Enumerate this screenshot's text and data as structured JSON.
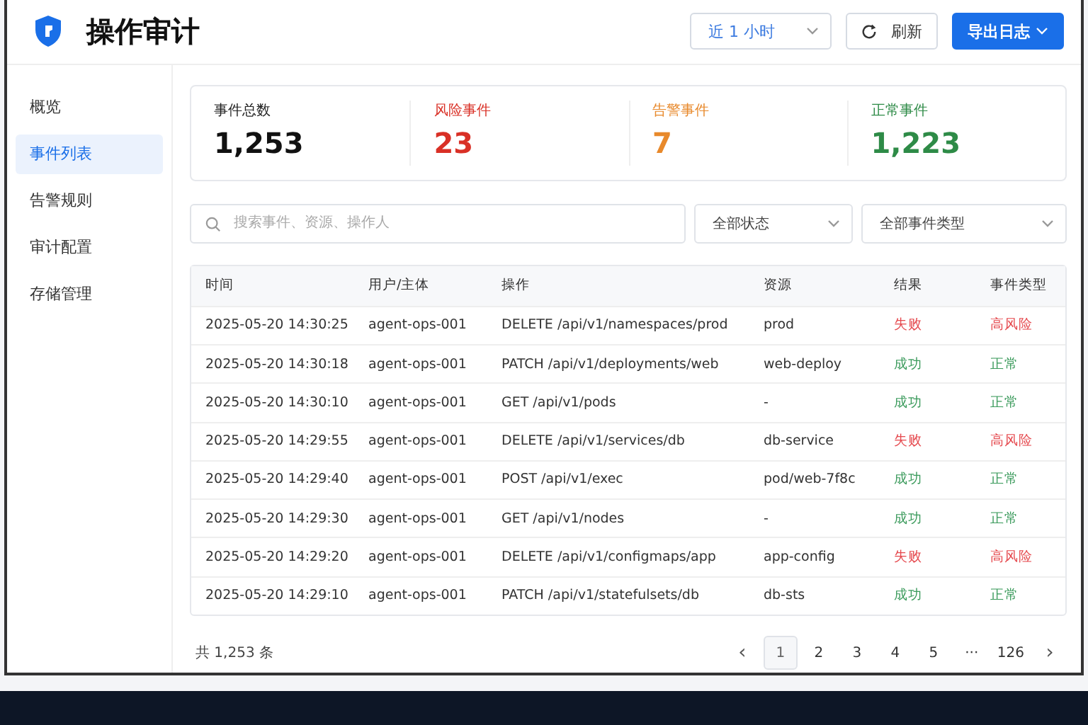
{
  "header": {
    "title": "操作审计",
    "time_range": "近 1 小时",
    "refresh": "刷新",
    "export": "导出日志"
  },
  "sidebar": {
    "items": [
      {
        "label": "概览",
        "selected": false
      },
      {
        "label": "事件列表",
        "selected": true
      },
      {
        "label": "告警规则",
        "selected": false
      },
      {
        "label": "审计配置",
        "selected": false
      },
      {
        "label": "存储管理",
        "selected": false
      }
    ]
  },
  "stats": [
    {
      "label": "事件总数",
      "value": "1,253",
      "kind": "total"
    },
    {
      "label": "风险事件",
      "value": "23",
      "kind": "risk"
    },
    {
      "label": "告警事件",
      "value": "7",
      "kind": "warning"
    },
    {
      "label": "正常事件",
      "value": "1,223",
      "kind": "normal"
    }
  ],
  "filters": {
    "search_placeholder": "搜索事件、资源、操作人",
    "status": "全部状态",
    "event_type": "全部事件类型"
  },
  "table": {
    "columns": [
      "时间",
      "用户/主体",
      "操作",
      "资源",
      "结果",
      "事件类型"
    ],
    "rows": [
      {
        "time": "2025-05-20 14:30:25",
        "user": "agent-ops-001",
        "operation": "DELETE /api/v1/namespaces/prod",
        "resource": "prod",
        "result": "失败",
        "event_type": "高风险",
        "kind": "fail"
      },
      {
        "time": "2025-05-20 14:30:18",
        "user": "agent-ops-001",
        "operation": "PATCH /api/v1/deployments/web",
        "resource": "web-deploy",
        "result": "成功",
        "event_type": "正常",
        "kind": "ok"
      },
      {
        "time": "2025-05-20 14:30:10",
        "user": "agent-ops-001",
        "operation": "GET /api/v1/pods",
        "resource": "-",
        "result": "成功",
        "event_type": "正常",
        "kind": "ok"
      },
      {
        "time": "2025-05-20 14:29:55",
        "user": "agent-ops-001",
        "operation": "DELETE /api/v1/services/db",
        "resource": "db-service",
        "result": "失败",
        "event_type": "高风险",
        "kind": "fail"
      },
      {
        "time": "2025-05-20 14:29:40",
        "user": "agent-ops-001",
        "operation": "POST /api/v1/exec",
        "resource": "pod/web-7f8c",
        "result": "成功",
        "event_type": "正常",
        "kind": "ok"
      },
      {
        "time": "2025-05-20 14:29:30",
        "user": "agent-ops-001",
        "operation": "GET /api/v1/nodes",
        "resource": "-",
        "result": "成功",
        "event_type": "正常",
        "kind": "ok"
      },
      {
        "time": "2025-05-20 14:29:20",
        "user": "agent-ops-001",
        "operation": "DELETE /api/v1/configmaps/app",
        "resource": "app-config",
        "result": "失败",
        "event_type": "高风险",
        "kind": "fail"
      },
      {
        "time": "2025-05-20 14:29:10",
        "user": "agent-ops-001",
        "operation": "PATCH /api/v1/statefulsets/db",
        "resource": "db-sts",
        "result": "成功",
        "event_type": "正常",
        "kind": "ok"
      }
    ]
  },
  "pagination": {
    "total": "共 1,253 条",
    "prev": "‹",
    "next": "›",
    "pages": [
      {
        "label": "1",
        "selected": true
      },
      {
        "label": "2",
        "selected": false
      },
      {
        "label": "3",
        "selected": false
      },
      {
        "label": "4",
        "selected": false
      },
      {
        "label": "5",
        "selected": false
      },
      {
        "label": "···",
        "selected": false
      },
      {
        "label": "126",
        "selected": false
      }
    ]
  }
}
